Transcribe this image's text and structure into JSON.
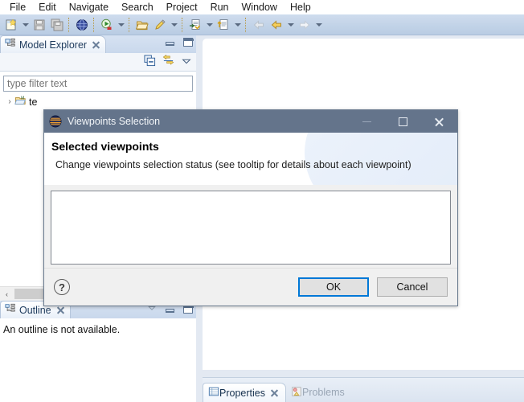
{
  "menubar": {
    "items": [
      {
        "label": "File"
      },
      {
        "label": "Edit"
      },
      {
        "label": "Navigate"
      },
      {
        "label": "Search"
      },
      {
        "label": "Project"
      },
      {
        "label": "Run"
      },
      {
        "label": "Window"
      },
      {
        "label": "Help"
      }
    ]
  },
  "toolbar": {
    "items": [
      {
        "icon": "new-wizard-icon",
        "dropdown": true
      },
      {
        "icon": "save-icon",
        "dropdown": false
      },
      {
        "icon": "save-all-icon",
        "dropdown": false
      },
      {
        "icon": "globe-validate-icon",
        "dropdown": false
      },
      {
        "icon": "run-icon",
        "dropdown": true
      },
      {
        "icon": "open-folder-icon",
        "dropdown": false
      },
      {
        "icon": "pencil-edit-icon",
        "dropdown": true
      },
      {
        "icon": "new-representation-icon",
        "dropdown": true
      },
      {
        "icon": "export-icon",
        "dropdown": true
      },
      {
        "icon": "back-grey-icon",
        "dropdown": false
      },
      {
        "icon": "back-icon",
        "dropdown": true
      },
      {
        "icon": "forward-icon",
        "dropdown": true
      }
    ]
  },
  "model_explorer": {
    "tab_label": "Model Explorer",
    "tab_close_icon": "close-icon",
    "view_icon": "model-explorer-icon",
    "minimize_icon": "minimize-icon",
    "maximize_icon": "maximize-icon",
    "toolbar": [
      {
        "icon": "collapse-all-icon"
      },
      {
        "icon": "link-with-editor-icon"
      },
      {
        "icon": "view-menu-chevron-icon"
      }
    ],
    "filter": {
      "value": "",
      "placeholder": "type filter text"
    },
    "tree": [
      {
        "expander": "›",
        "icon": "project-folder-icon",
        "label": "te"
      }
    ],
    "hscroll": {
      "left_arrow": "‹"
    }
  },
  "outline": {
    "tab_label": "Outline",
    "tab_close_icon": "close-icon",
    "view_icon": "outline-icon",
    "message": "An outline is not available.",
    "minimize_icon": "minimize-icon",
    "maximize_icon": "maximize-icon",
    "menu_icon": "view-menu-chevron-icon"
  },
  "bottom_tabs": [
    {
      "label": "Properties",
      "icon": "properties-icon",
      "active": true,
      "close_icon": "close-icon"
    },
    {
      "label": "Problems",
      "icon": "problems-icon",
      "active": false
    }
  ],
  "dialog": {
    "title": "Viewpoints Selection",
    "title_icon": "viewpoint-globe-icon",
    "minimize_icon": "minimize-icon",
    "maximize_icon": "maximize-icon",
    "close_icon": "close-icon",
    "heading": "Selected viewpoints",
    "subheading": "Change viewpoints selection status (see tooltip for details about each viewpoint)",
    "list_items": [],
    "help_icon": "help-question-icon",
    "buttons": {
      "ok": "OK",
      "cancel": "Cancel"
    }
  },
  "colors": {
    "dialog_titlebar": "#64748b",
    "focus_blue": "#0078d7",
    "toolbar_blue": "#c3d4e8",
    "workbench_bg": "#e3e9f2"
  }
}
